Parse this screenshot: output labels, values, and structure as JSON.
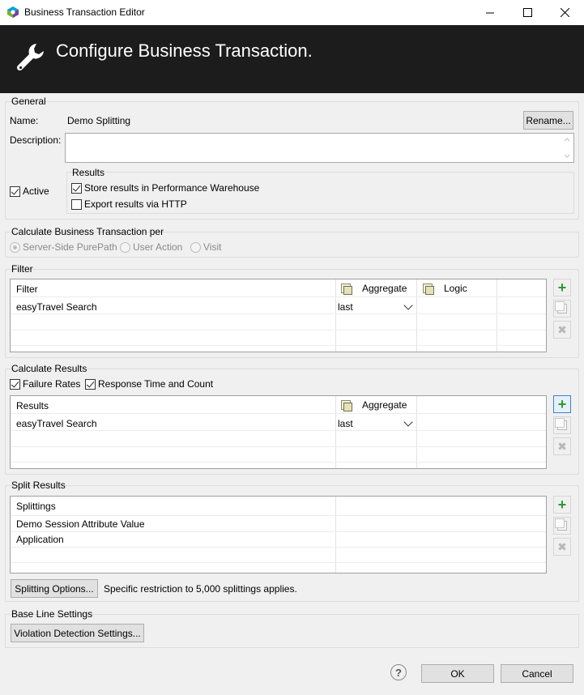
{
  "window": {
    "title": "Business Transaction Editor",
    "minimize_glyph": "—",
    "maximize_glyph": "☐",
    "close_glyph": "✕"
  },
  "banner": {
    "title": "Configure Business Transaction.",
    "icon": "wrench-icon"
  },
  "general": {
    "legend": "General",
    "name_label": "Name:",
    "name_value": "Demo Splitting",
    "rename_button": "Rename...",
    "description_label": "Description:",
    "description_value": "",
    "active_label": "Active",
    "active_checked": true,
    "results": {
      "legend": "Results",
      "store_label": "Store results in Performance Warehouse",
      "store_checked": true,
      "export_label": "Export results via HTTP",
      "export_checked": false
    }
  },
  "calculate_per": {
    "legend": "Calculate Business Transaction per",
    "options": [
      "Server-Side PurePath",
      "User Action",
      "Visit"
    ],
    "selected": "Server-Side PurePath"
  },
  "filter": {
    "legend": "Filter",
    "columns": [
      "Filter",
      "Aggregate",
      "Logic"
    ],
    "rows": [
      {
        "filter": "easyTravel Search",
        "aggregate": "last",
        "logic": ""
      }
    ]
  },
  "calculate_results": {
    "legend": "Calculate Results",
    "failure_label": "Failure Rates",
    "failure_checked": true,
    "response_label": "Response Time and Count",
    "response_checked": true,
    "columns": [
      "Results",
      "Aggregate"
    ],
    "rows": [
      {
        "result": "easyTravel Search",
        "aggregate": "last"
      }
    ]
  },
  "split_results": {
    "legend": "Split Results",
    "column": "Splittings",
    "rows": [
      "Demo Session Attribute Value",
      "Application"
    ],
    "options_button": "Splitting Options...",
    "restriction_text": "Specific restriction to 5,000 splittings applies."
  },
  "baseline": {
    "legend": "Base Line Settings",
    "violation_button": "Violation Detection Settings..."
  },
  "footer": {
    "help_glyph": "?",
    "ok": "OK",
    "cancel": "Cancel"
  },
  "colors": {
    "banner_bg": "#1c1c1c",
    "add_green": "#2d9a2d",
    "focus_blue": "#3c7fd0"
  }
}
